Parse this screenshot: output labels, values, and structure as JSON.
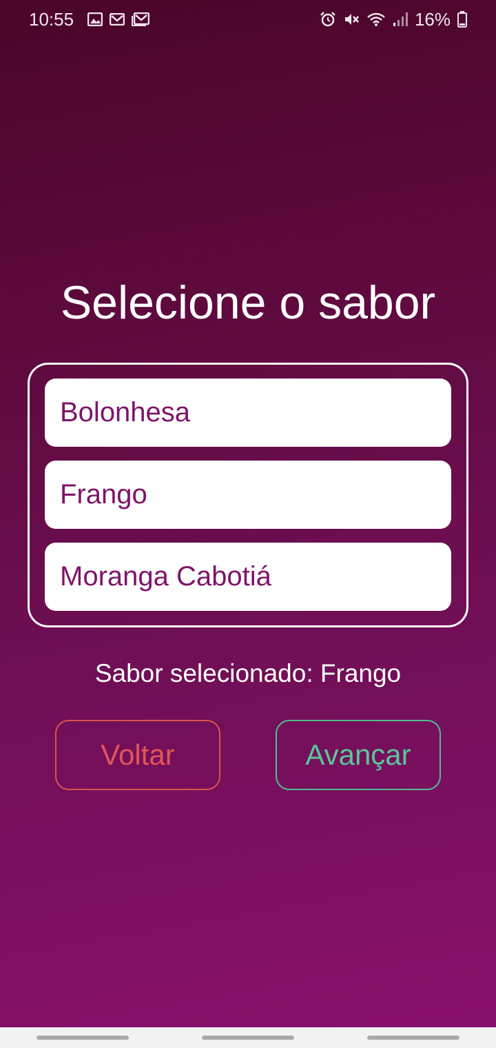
{
  "status_bar": {
    "time": "10:55",
    "battery": "16%",
    "left_icons": [
      "image-icon",
      "gmail-icon",
      "gmail-icon"
    ],
    "right_icons": [
      "alarm-icon",
      "mute-icon",
      "wifi-icon",
      "signal-icon",
      "battery-icon"
    ]
  },
  "screen": {
    "title": "Selecione o sabor",
    "options": [
      "Bolonhesa",
      "Frango",
      "Moranga Cabotiá"
    ],
    "selected_label": "Sabor selecionado: Frango"
  },
  "buttons": {
    "back": "Voltar",
    "next": "Avançar"
  },
  "colors": {
    "background_top": "#4a0628",
    "background_bottom": "#88106f",
    "option_text": "#7d1469",
    "back_accent": "#d8554f",
    "next_accent": "#4dbf93"
  }
}
